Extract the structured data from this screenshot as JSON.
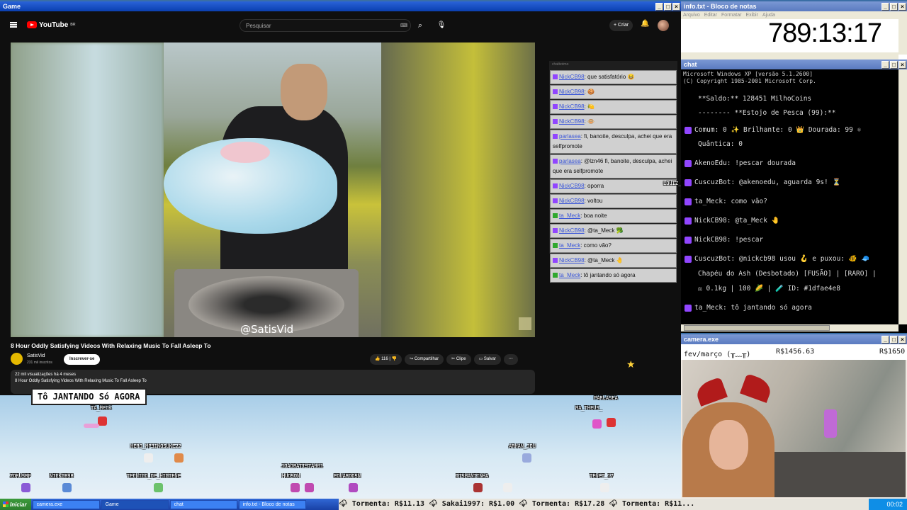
{
  "game_window": {
    "title": "Game"
  },
  "youtube": {
    "logo_text": "YouTube",
    "logo_sup": "BR",
    "search_placeholder": "Pesquisar",
    "create_label": "+ Criar",
    "video_title": "8 Hour Oddly Satisfying Videos With Relaxing Music To Fall Asleep To",
    "watermark": "@SatisVid",
    "channel_name": "SatisVid",
    "channel_subs": "231 mil inscritos",
    "subscribe_label": "Inscrever-se",
    "likes": "116",
    "share_label": "Compartilhar",
    "clip_label": "Clipe",
    "save_label": "Salvar",
    "views_line": "22 mil visualizações  há 4 meses",
    "desc_line": "8 Hour Oddly Satisfying Videos With Relaxing Music To Fall Asleep To"
  },
  "overlay_chat": {
    "header": "chatbotmo",
    "messages": [
      {
        "user": "NickCB98",
        "text": ": que satisfatório 😆"
      },
      {
        "user": "NickCB98",
        "text": ": 🍪"
      },
      {
        "user": "NickCB98",
        "text": ": 🍋"
      },
      {
        "user": "NickCB98",
        "text": ": 🐵"
      },
      {
        "user": "parlasea",
        "text": ": fi, banoite, desculpa, achei que era selfpromote"
      },
      {
        "user": "parlasea",
        "text": ": @lzn46 fi, banoite, desculpa, achei que era selfpromote"
      },
      {
        "user": "NickCB98",
        "text": ": oporra"
      },
      {
        "user": "NickCB98",
        "text": ": voltou"
      },
      {
        "user": "ta_Meck",
        "text": ": boa noite"
      },
      {
        "user": "NickCB98",
        "text": ": @ta_Meck 🥦"
      },
      {
        "user": "ta_Meck",
        "text": ": como vão?"
      },
      {
        "user": "NickCB98",
        "text": ": @ta_Meck 🤚"
      },
      {
        "user": "ta_Meck",
        "text": ": tô jantando só agora"
      }
    ]
  },
  "stage": {
    "speech": "Tô JANTANDO Só AGORA",
    "nicks": {
      "a": "TA_MECK",
      "b": "PARLASEA",
      "c": "MA_THEUS_",
      "d": "HERO_MP3INOSUKE22",
      "e": "ARHAN_JOU",
      "f": "ZORUSBP",
      "g": "NICKCB98",
      "h": "TECNICO_DE_HIGIENE",
      "i": "JOAOBATISTA001",
      "j": "HUDSON",
      "k": "EDUARDOSN",
      "l": "ITSMANTINHA",
      "m": "TENET_17",
      "n": "LOUIZ_HADDOCK"
    }
  },
  "notepad": {
    "title": "info.txt - Bloco de notas",
    "menu": [
      "Arquivo",
      "Editar",
      "Formatar",
      "Exibir",
      "Ajuda"
    ],
    "timer": "789:13:17"
  },
  "chat_window": {
    "title": "chat",
    "header_line1": "Microsoft Windows XP [versão 5.1.2600]",
    "header_line2": "(C) Copyright 1985-2001 Microsoft Corp.",
    "lines": [
      "**Saldo:** 128451 MilhoCoins",
      "--------  **Estojo de Pesca (99):**",
      "Comum: 0  ✨ Brilhante: 0  👑 Dourada: 99  ⚛",
      "Quântica: 0",
      "AkenoEdu: !pescar dourada",
      "CuscuzBot: @akenoedu, aguarda 9s! ⏳",
      "ta_Meck: como vão?",
      "NickCB98: @ta_Meck 🤚",
      "NickCB98: !pescar",
      "CuscuzBot: @nickcb98 usou 🪝 e puxou: 🐠 🧢",
      "Chapéu do Ash (Desbotado) [FUSÃO] | [RARO] |",
      "⚖ 0.1kg | 100 🌽 | 🧪 ID: #1dfae4e8",
      "ta_Meck: tô jantando só agora"
    ]
  },
  "camera_window": {
    "title": "camera.exe",
    "label": "fev/março (╥﹏╥)",
    "amount1": "R$1456.63",
    "amount2": "R$1650"
  },
  "taskbar": {
    "start": "Iniciar",
    "tasks": [
      "camera.exe",
      "Game",
      "chat",
      "info.txt - Bloco de notas"
    ],
    "ticker": "🌩 Tormenta: R$11.13  🌩 Sakai1997: R$1.00  🌩 Tormenta: R$17.28  🌩 Tormenta: R$11...",
    "clock": "00:02"
  }
}
